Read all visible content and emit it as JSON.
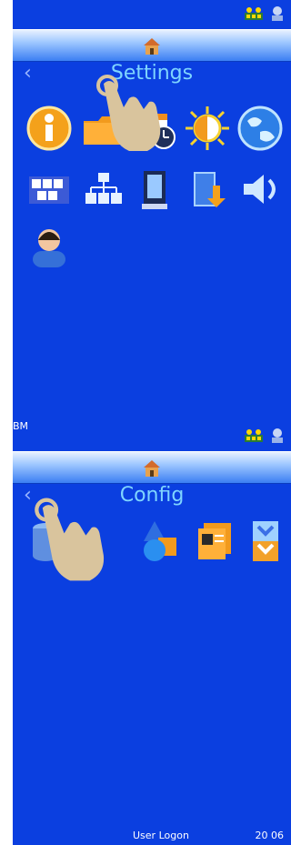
{
  "screen1": {
    "status_left_text": "",
    "title": "Settings",
    "icons_row1": [
      "info-icon",
      "folder-icon",
      "calendar-clock-icon",
      "brightness-icon",
      "globe-icon"
    ],
    "icons_row2": [
      "keyboard-icon",
      "network-icon",
      "printer-icon",
      "import-export-icon",
      "speaker-icon"
    ],
    "icons_row3": [
      "user-icon"
    ],
    "status_icons": [
      "network-status-icon",
      "user-status-icon"
    ]
  },
  "screen2": {
    "status_left_text": "BM",
    "title": "Config",
    "icons_row1": [
      "database-document-icon",
      "shapes-icon",
      "label-template-icon",
      "chevrons-panel-icon"
    ],
    "footer_user": "User Logon",
    "footer_time": "20 06",
    "status_icons": [
      "network-status-icon",
      "user-status-icon"
    ]
  },
  "colors": {
    "screen_bg": "#0b3fe0",
    "title_color": "#7fd5ff"
  }
}
